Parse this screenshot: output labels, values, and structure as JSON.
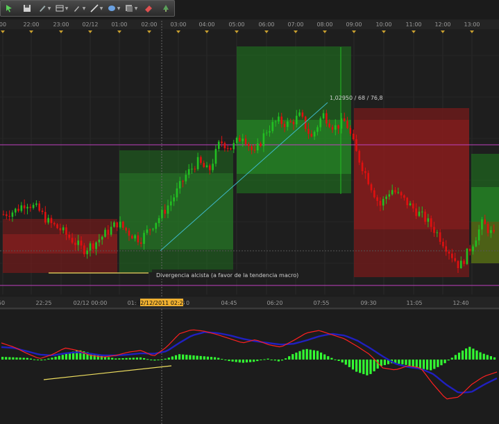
{
  "toolbar": {
    "buttons": [
      {
        "icon": "arrow-cursor-icon"
      },
      {
        "icon": "save-icon"
      },
      {
        "icon": "draw-pencil-icon"
      },
      {
        "icon": "layout-icon"
      },
      {
        "icon": "pen-tool-icon"
      },
      {
        "icon": "line-tool-icon"
      },
      {
        "icon": "shape-ellipse-icon"
      },
      {
        "icon": "template-icon"
      },
      {
        "icon": "eraser-icon"
      },
      {
        "icon": "tree-icon"
      }
    ]
  },
  "colors": {
    "background": "#1b1b1b",
    "bull_candle": "#22c022",
    "bear_candle": "#e01010",
    "bull_zone": "#1f6e1f",
    "bear_zone": "#7a1a1a",
    "magenta_level": "#c040c0",
    "trend_line": "#3fb8c8",
    "divergence_line": "#f0e060",
    "histogram": "#33ff33",
    "macd_signal": "#2020c0",
    "macd_line": "#ff2020",
    "highlight_label": "#f0b030"
  },
  "chart_data": {
    "type": "candlestick",
    "top_time_axis": [
      "00",
      "22:00",
      "23:00",
      "02/12",
      "01:00",
      "02:00",
      "03:00",
      "04:00",
      "05:00",
      "06:00",
      "07:00",
      "08:00",
      "09:00",
      "10:00",
      "11:00",
      "12:00",
      "13:00"
    ],
    "bottom_time_axis": [
      "50",
      "22:25",
      "02/12 00:00",
      "01:",
      "10",
      "04:45",
      "06:20",
      "07:55",
      "09:30",
      "11:05",
      "12:40"
    ],
    "cursor_time_label": "02/12/2011 02:25",
    "annotation_measure": "1,02950 / 68 / 76,8",
    "annotation_note": "Divergencia alcista (a favor de la tendencia macro)",
    "legs": [
      0.35,
      0.37,
      0.42,
      0.38,
      0.3,
      0.26,
      0.2,
      0.14,
      0.18,
      0.24,
      0.3,
      0.24,
      0.2,
      0.28,
      0.36,
      0.46,
      0.58,
      0.66,
      0.6,
      0.78,
      0.74,
      0.82,
      0.7,
      0.84,
      0.9,
      0.88,
      0.93,
      0.8,
      0.94,
      0.86,
      0.9,
      0.7,
      0.55,
      0.4,
      0.5,
      0.44,
      0.38,
      0.32,
      0.24,
      0.14,
      0.04,
      0.16,
      0.3,
      0.22
    ],
    "osc_fast": [
      0.4,
      0.3,
      0.15,
      0.02,
      0.12,
      0.28,
      0.22,
      0.1,
      0.06,
      0.1,
      0.18,
      0.22,
      0.08,
      0.3,
      0.62,
      0.72,
      0.68,
      0.6,
      0.5,
      0.4,
      0.48,
      0.36,
      0.3,
      0.46,
      0.64,
      0.7,
      0.6,
      0.5,
      0.32,
      0.12,
      -0.2,
      -0.25,
      -0.15,
      -0.2,
      -0.6,
      -0.95,
      -0.9,
      -0.6,
      -0.4,
      -0.3
    ],
    "osc_slow": [
      0.3,
      0.28,
      0.2,
      0.12,
      0.1,
      0.15,
      0.18,
      0.14,
      0.1,
      0.1,
      0.12,
      0.15,
      0.14,
      0.2,
      0.4,
      0.58,
      0.66,
      0.64,
      0.58,
      0.5,
      0.44,
      0.4,
      0.36,
      0.38,
      0.46,
      0.56,
      0.62,
      0.58,
      0.46,
      0.28,
      0.08,
      -0.1,
      -0.18,
      -0.22,
      -0.35,
      -0.6,
      -0.8,
      -0.78,
      -0.6,
      -0.45
    ],
    "histogram": [
      0.05,
      0.04,
      0.03,
      -0.02,
      0.04,
      0.1,
      0.18,
      0.12,
      0.06,
      0.02,
      0.03,
      0.04,
      -0.02,
      0.02,
      0.1,
      0.08,
      0.06,
      0.04,
      -0.03,
      -0.06,
      -0.04,
      0.02,
      -0.04,
      0.1,
      0.2,
      0.16,
      0.04,
      -0.06,
      -0.22,
      -0.3,
      -0.12,
      -0.06,
      -0.1,
      -0.16,
      -0.2,
      -0.08,
      0.1,
      0.24,
      0.12,
      0.04
    ]
  }
}
